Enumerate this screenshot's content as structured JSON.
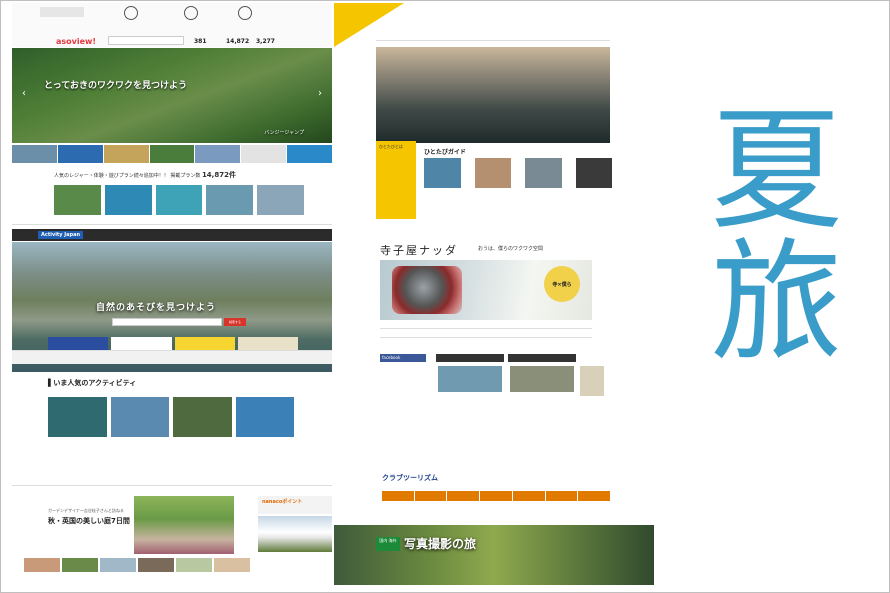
{
  "title": {
    "text": "夏旅"
  },
  "asoview": {
    "logo": "asoview!",
    "hero_title": "とっておきのワクワクを見つけよう",
    "hero_caption": "バンジージャンプ",
    "stats": [
      "381",
      "14,872",
      "3,277"
    ],
    "plans_heading": "人気のレジャー・体験・遊びプラン続々追加中！！ 掲載プラン数",
    "plans_count": "14,872件"
  },
  "hitotabi": {
    "guide_title": "ひとたびガイド",
    "side_label": "ひとたびとは"
  },
  "activityjapan": {
    "brand": "Activity Japan",
    "hero_title": "自然のあそびを見つけよう",
    "search_button": "検索する",
    "banner_text": "バンジージャンプ",
    "popular_title": "いま人気のアクティビティ"
  },
  "terakoya": {
    "logo": "寺子屋ナッダ",
    "tagline": "おうは、僕らのワクワク空間",
    "circle_text": "寺×僕ら",
    "facebook": "facebook"
  },
  "clubtourism": {
    "brand": "クラブツーリズム",
    "hero_title": "写真撮影の旅",
    "badge": "国内 海外"
  },
  "garden": {
    "title": "秋・英国の美しい庭7日間",
    "subtitle": "ガーデンデザイナー吉谷桂子さんと訪ねる",
    "nanaco": "nanacoポイント"
  },
  "colors": {
    "title_blue": "#3a9cc9",
    "hitotabi_yellow": "#f5c500",
    "club_orange": "#e07a00"
  }
}
